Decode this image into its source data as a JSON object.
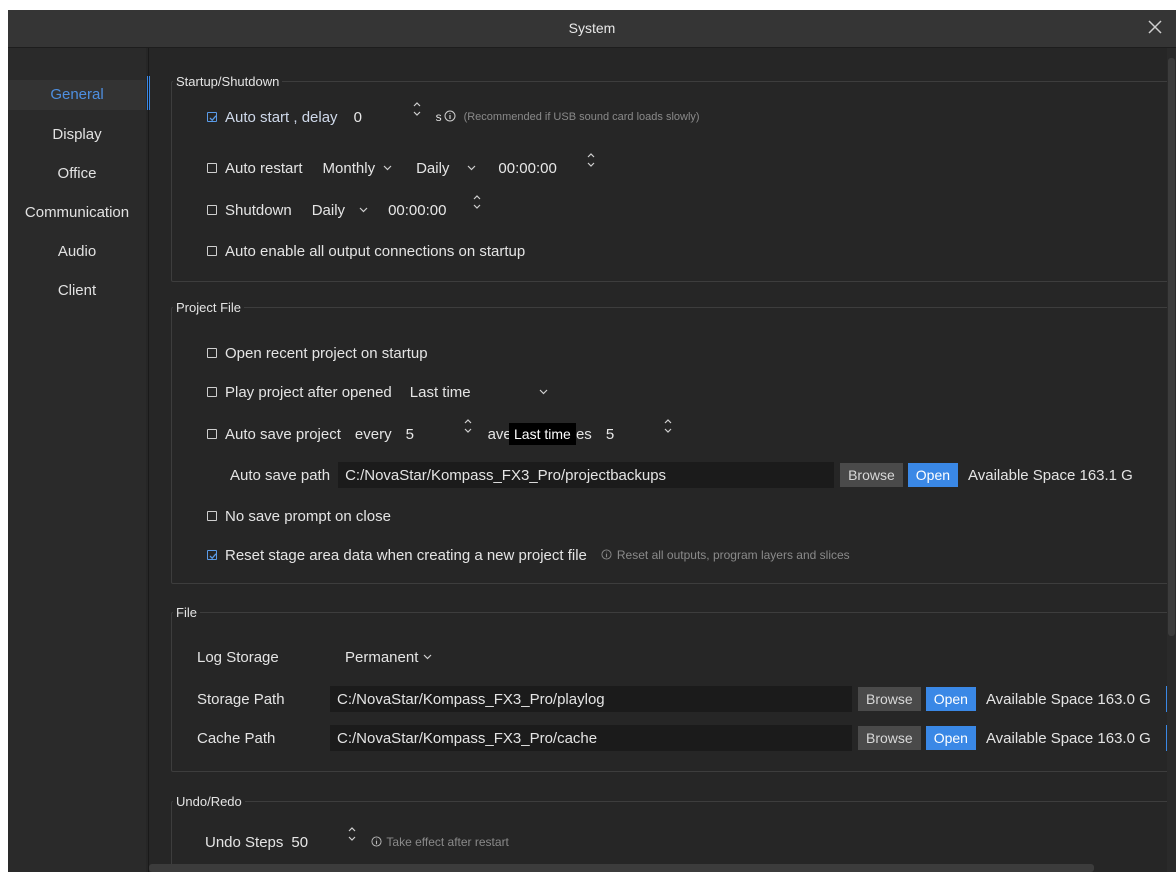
{
  "window": {
    "title": "System"
  },
  "sidebar": {
    "items": [
      {
        "label": "General"
      },
      {
        "label": "Display"
      },
      {
        "label": "Office"
      },
      {
        "label": "Communication"
      },
      {
        "label": "Audio"
      },
      {
        "label": "Client"
      }
    ],
    "active_index": 0
  },
  "startup": {
    "legend": "Startup/Shutdown",
    "auto_start": {
      "label": "Auto start , delay",
      "checked": true,
      "value": "0",
      "unit": "s",
      "hint": "(Recommended if USB sound card loads slowly)"
    },
    "auto_restart": {
      "label": "Auto restart",
      "checked": false,
      "period": "Monthly",
      "day": "Daily",
      "time": "00:00:00"
    },
    "shutdown": {
      "label": "Shutdown",
      "checked": false,
      "period": "Daily",
      "time": "00:00:00"
    },
    "auto_enable": {
      "label": "Auto enable all output connections on startup",
      "checked": false
    }
  },
  "project": {
    "legend": "Project File",
    "open_recent": {
      "label": "Open recent project on startup",
      "checked": false
    },
    "play_after": {
      "label": "Play project after opened",
      "checked": false,
      "mode": "Last time"
    },
    "auto_save": {
      "label": "Auto save project",
      "checked": false,
      "every_label": "every",
      "every_value": "5",
      "tooltip": "Last time",
      "max_label": "ave, max saves",
      "max_value": "5"
    },
    "auto_save_path": {
      "label": "Auto save path",
      "value": "C:/NovaStar/Kompass_FX3_Pro/projectbackups",
      "browse": "Browse",
      "open": "Open",
      "space": "Available Space 163.1 G"
    },
    "no_prompt": {
      "label": "No save prompt on close",
      "checked": false
    },
    "reset_stage": {
      "label": "Reset stage area data when creating a new project file",
      "checked": true,
      "hint": "Reset all outputs, program layers and slices"
    }
  },
  "file": {
    "legend": "File",
    "log_storage": {
      "label": "Log Storage",
      "value": "Permanent"
    },
    "storage_path": {
      "label": "Storage Path",
      "value": "C:/NovaStar/Kompass_FX3_Pro/playlog",
      "browse": "Browse",
      "open": "Open",
      "space": "Available Space 163.0 G"
    },
    "cache_path": {
      "label": "Cache Path",
      "value": "C:/NovaStar/Kompass_FX3_Pro/cache",
      "browse": "Browse",
      "open": "Open",
      "space": "Available Space 163.0 G"
    }
  },
  "undo": {
    "legend": "Undo/Redo",
    "steps": {
      "label": "Undo Steps",
      "value": "50",
      "hint": "Take effect after restart"
    }
  },
  "colors": {
    "accent": "#3a88e6",
    "background": "#262626",
    "sidebar": "#2a2a2a",
    "text": "#e4e4e4",
    "hint": "#8a8a8a"
  }
}
